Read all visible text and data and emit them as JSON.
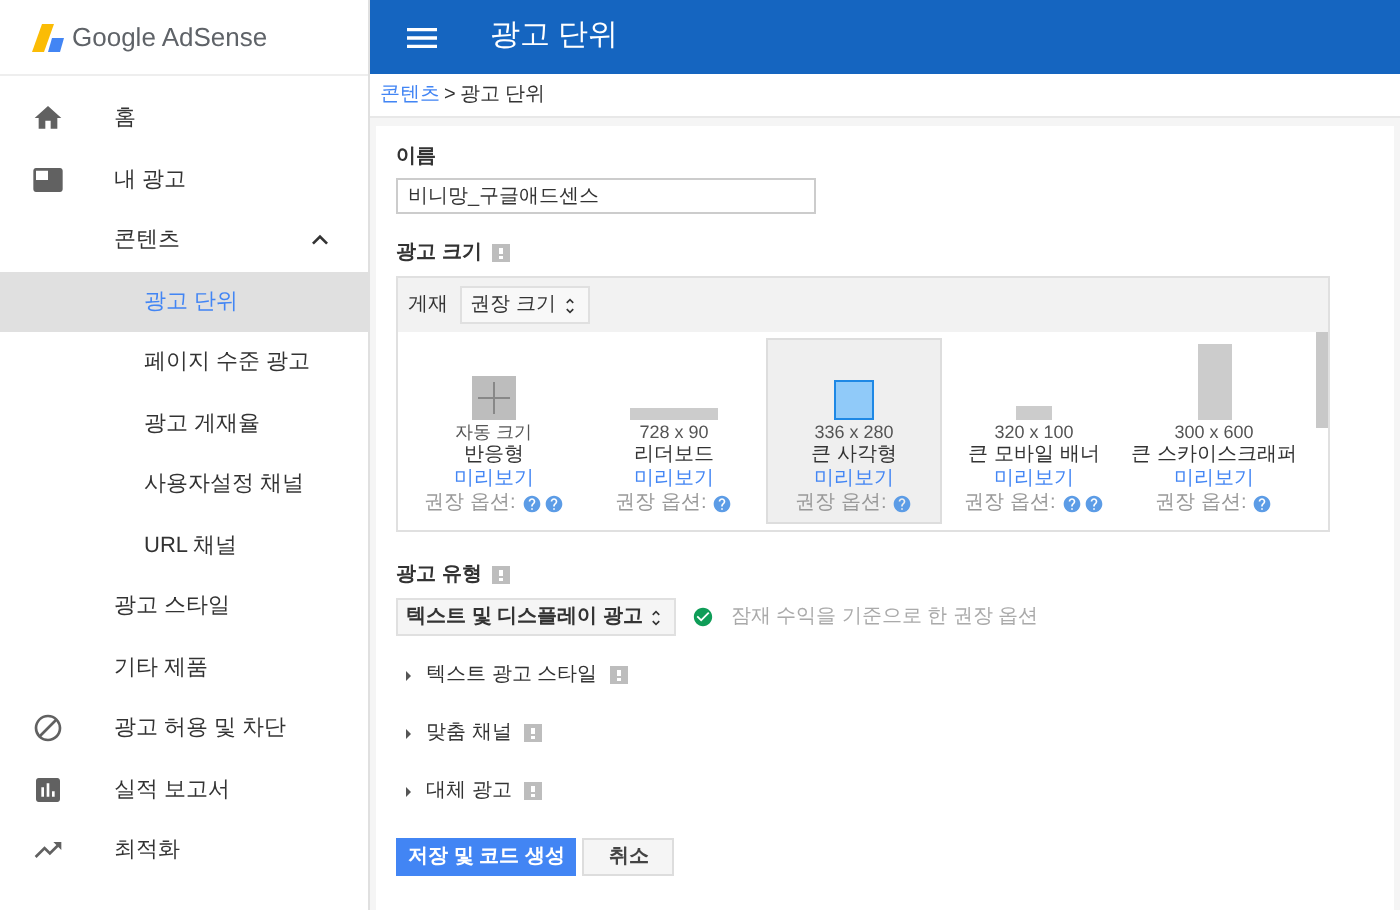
{
  "logo": {
    "text": "Google AdSense"
  },
  "header": {
    "title": "광고 단위"
  },
  "breadcrumb": {
    "link": "콘텐츠",
    "separator": ">",
    "current": "광고 단위"
  },
  "sidebar": {
    "items": [
      {
        "label": "홈",
        "kind": "home",
        "selected": false
      },
      {
        "label": "내 광고",
        "kind": "ads",
        "selected": false,
        "children": [
          {
            "label": "콘텐츠",
            "selected": false,
            "expanded": true,
            "children": [
              {
                "label": "광고 단위",
                "selected": true
              },
              {
                "label": "페이지 수준 광고",
                "selected": false
              },
              {
                "label": "광고 게재율",
                "selected": false
              },
              {
                "label": "사용자설정 채널",
                "selected": false
              },
              {
                "label": "URL 채널",
                "selected": false
              }
            ]
          },
          {
            "label": "광고 스타일",
            "selected": false
          },
          {
            "label": "기타 제품",
            "selected": false
          }
        ]
      },
      {
        "label": "광고 허용 및 차단",
        "kind": "block",
        "selected": false
      },
      {
        "label": "실적 보고서",
        "kind": "report",
        "selected": false
      },
      {
        "label": "최적화",
        "kind": "trend",
        "selected": false
      }
    ]
  },
  "name_field": {
    "label": "이름",
    "value": "비니망_구글애드센스"
  },
  "ad_size": {
    "label": "광고 크기",
    "filter_label": "게재",
    "filter_value": "권장 크기",
    "sizes": [
      {
        "kind": "responsive",
        "dimensions": "자동 크기",
        "name": "반응형",
        "link": "미리보기",
        "hint": "권장 옵션:",
        "help_icons": [
          {
            "kind": "help"
          },
          {
            "kind": "help"
          }
        ],
        "selected": false
      },
      {
        "kind": "leaderboard",
        "dimensions": "728 x 90",
        "name": "리더보드",
        "link": "미리보기",
        "hint": "권장 옵션:",
        "help_icons": [
          {
            "kind": "help"
          }
        ],
        "selected": false
      },
      {
        "kind": "rectangle",
        "dimensions": "336 x 280",
        "name": "큰 사각형",
        "link": "미리보기",
        "hint": "권장 옵션:",
        "help_icons": [
          {
            "kind": "help"
          }
        ],
        "selected": true
      },
      {
        "kind": "mobile",
        "dimensions": "320 x 100",
        "name": "큰 모바일 배너",
        "link": "미리보기",
        "hint": "권장 옵션:",
        "help_icons": [
          {
            "kind": "help"
          },
          {
            "kind": "help"
          }
        ],
        "selected": false
      },
      {
        "kind": "skyscraper",
        "dimensions": "300 x 600",
        "name": "큰 스카이스크래퍼",
        "link": "미리보기",
        "hint": "권장 옵션:",
        "help_icons": [
          {
            "kind": "help"
          }
        ],
        "selected": false
      }
    ]
  },
  "ad_type": {
    "label": "광고 유형",
    "value": "텍스트 및 디스플레이 광고",
    "note": "잠재 수익을 기준으로 한 권장 옵션"
  },
  "sections": [
    {
      "label": "텍스트 광고 스타일",
      "expanded": false
    },
    {
      "label": "맞춤 채널",
      "expanded": false
    },
    {
      "label": "대체 광고",
      "expanded": false
    }
  ],
  "buttons": [
    {
      "label": "저장 및 코드 생성",
      "kind": "primary"
    },
    {
      "label": "취소",
      "kind": "secondary"
    }
  ]
}
